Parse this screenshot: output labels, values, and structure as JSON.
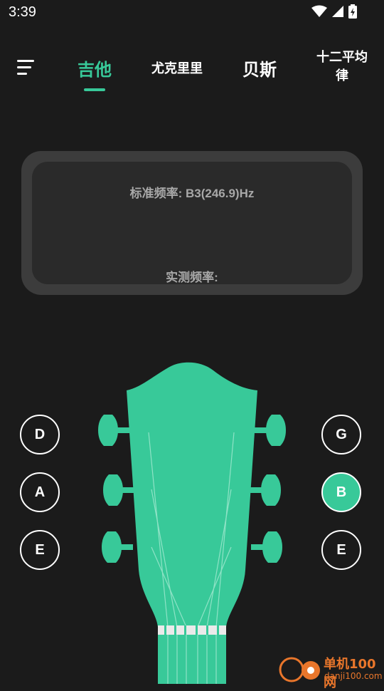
{
  "status": {
    "time": "3:39",
    "icons": [
      "wifi-icon",
      "cell-signal-icon",
      "battery-charging-icon"
    ]
  },
  "colors": {
    "accent": "#38c999",
    "background": "#1b1b1b",
    "panel_outer": "#3c3c3c",
    "panel_inner": "#2a2a2a",
    "label_gray": "#a8a8a8"
  },
  "header": {
    "menu_icon": "menu-icon",
    "tabs": [
      {
        "label": "吉他",
        "selected": true
      },
      {
        "label": "尤克里里",
        "selected": false
      },
      {
        "label": "贝斯",
        "selected": false
      },
      {
        "label_line1": "十二平均",
        "label_line2": "律",
        "selected": false
      }
    ]
  },
  "frequency_panel": {
    "standard_label": "标准频率: B3(246.9)Hz",
    "measured_label": "实测频率:"
  },
  "strings": {
    "left": [
      {
        "note": "D",
        "selected": false
      },
      {
        "note": "A",
        "selected": false
      },
      {
        "note": "E",
        "selected": false
      }
    ],
    "right": [
      {
        "note": "G",
        "selected": false
      },
      {
        "note": "B",
        "selected": true
      },
      {
        "note": "E",
        "selected": false
      }
    ]
  },
  "watermark": {
    "name": "单机100网",
    "site": "danji100.com"
  }
}
